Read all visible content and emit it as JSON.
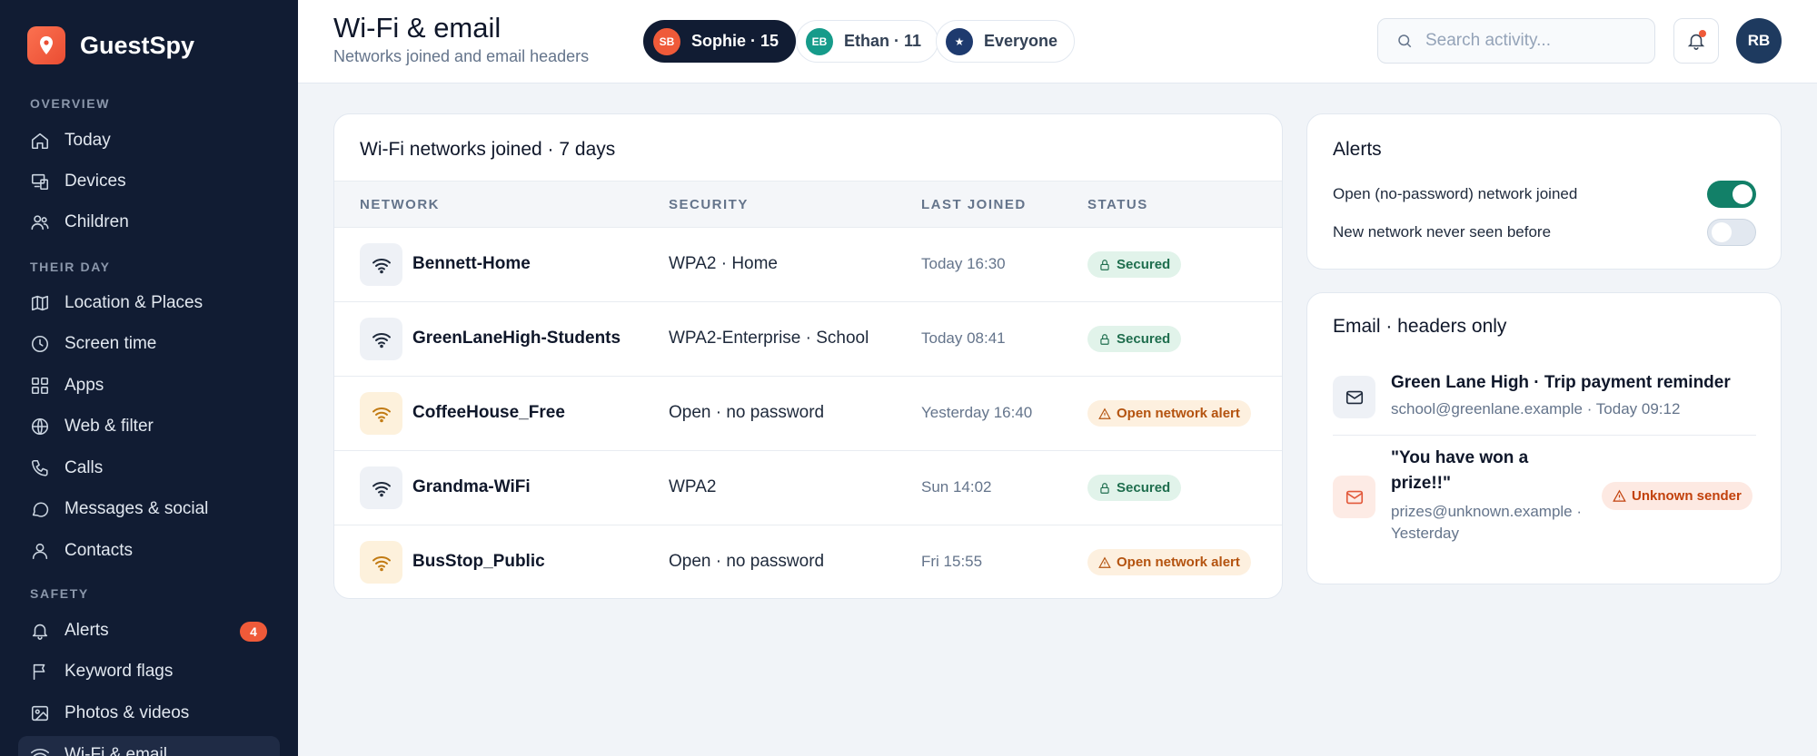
{
  "app": {
    "name": "GuestSpy"
  },
  "sidebar": {
    "sections": [
      {
        "label": "OVERVIEW"
      },
      {
        "label": "THEIR DAY"
      },
      {
        "label": "SAFETY"
      }
    ],
    "items": [
      {
        "label": "Today",
        "icon": "home-icon"
      },
      {
        "label": "Devices",
        "icon": "devices-icon"
      },
      {
        "label": "Children",
        "icon": "users-icon"
      },
      {
        "label": "Location & Places",
        "icon": "map-icon"
      },
      {
        "label": "Screen time",
        "icon": "clock-icon"
      },
      {
        "label": "Apps",
        "icon": "apps-grid-icon"
      },
      {
        "label": "Web & filter",
        "icon": "globe-icon"
      },
      {
        "label": "Calls",
        "icon": "phone-icon"
      },
      {
        "label": "Messages & social",
        "icon": "chat-icon"
      },
      {
        "label": "Contacts",
        "icon": "user-icon"
      },
      {
        "label": "Alerts",
        "icon": "bell-icon",
        "badge": "4"
      },
      {
        "label": "Keyword flags",
        "icon": "flag-icon"
      },
      {
        "label": "Photos & videos",
        "icon": "image-icon"
      },
      {
        "label": "Wi-Fi & email",
        "icon": "wifi-icon",
        "active": true
      }
    ]
  },
  "header": {
    "title": "Wi-Fi & email",
    "subtitle": "Networks joined and email headers",
    "profiles": [
      {
        "initials": "SB",
        "label": "Sophie · 15",
        "color": "#ef5a39",
        "selected": true
      },
      {
        "initials": "EB",
        "label": "Ethan · 11",
        "color": "#169b8a",
        "selected": false
      },
      {
        "initials": "★",
        "label": "Everyone",
        "color": "#1e3a6e",
        "selected": false
      }
    ],
    "search_placeholder": "Search activity...",
    "user_initials": "RB"
  },
  "wifi": {
    "title": "Wi-Fi networks joined · 7 days",
    "columns": [
      "NETWORK",
      "SECURITY",
      "LAST JOINED",
      "STATUS"
    ],
    "rows": [
      {
        "name": "Bennett-Home",
        "security": "WPA2 · Home",
        "last_joined": "Today 16:30",
        "status": "Secured",
        "kind": "ok"
      },
      {
        "name": "GreenLaneHigh-Students",
        "security": "WPA2-Enterprise · School",
        "last_joined": "Today 08:41",
        "status": "Secured",
        "kind": "ok"
      },
      {
        "name": "CoffeeHouse_Free",
        "security": "Open · no password",
        "last_joined": "Yesterday 16:40",
        "status": "Open network alert",
        "kind": "warn"
      },
      {
        "name": "Grandma-WiFi",
        "security": "WPA2",
        "last_joined": "Sun 14:02",
        "status": "Secured",
        "kind": "ok"
      },
      {
        "name": "BusStop_Public",
        "security": "Open · no password",
        "last_joined": "Fri 15:55",
        "status": "Open network alert",
        "kind": "warn"
      }
    ]
  },
  "alerts": {
    "title": "Alerts",
    "items": [
      {
        "label": "Open (no-password) network joined",
        "enabled": true
      },
      {
        "label": "New network never seen before",
        "enabled": false
      }
    ]
  },
  "email": {
    "title": "Email · headers only",
    "messages": [
      {
        "subject": "Green Lane High · Trip payment reminder",
        "meta": "school@greenlane.example · Today 09:12",
        "flag": ""
      },
      {
        "subject": "\"You have won a prize!!\"",
        "meta": "prizes@unknown.example · Yesterday",
        "flag": "Unknown sender"
      }
    ]
  },
  "colors": {
    "sidebar_bg": "#111c33",
    "accent": "#ef5a39",
    "toggle_on": "#128068",
    "secured": "#1f6e4e",
    "warning": "#b4530f"
  }
}
